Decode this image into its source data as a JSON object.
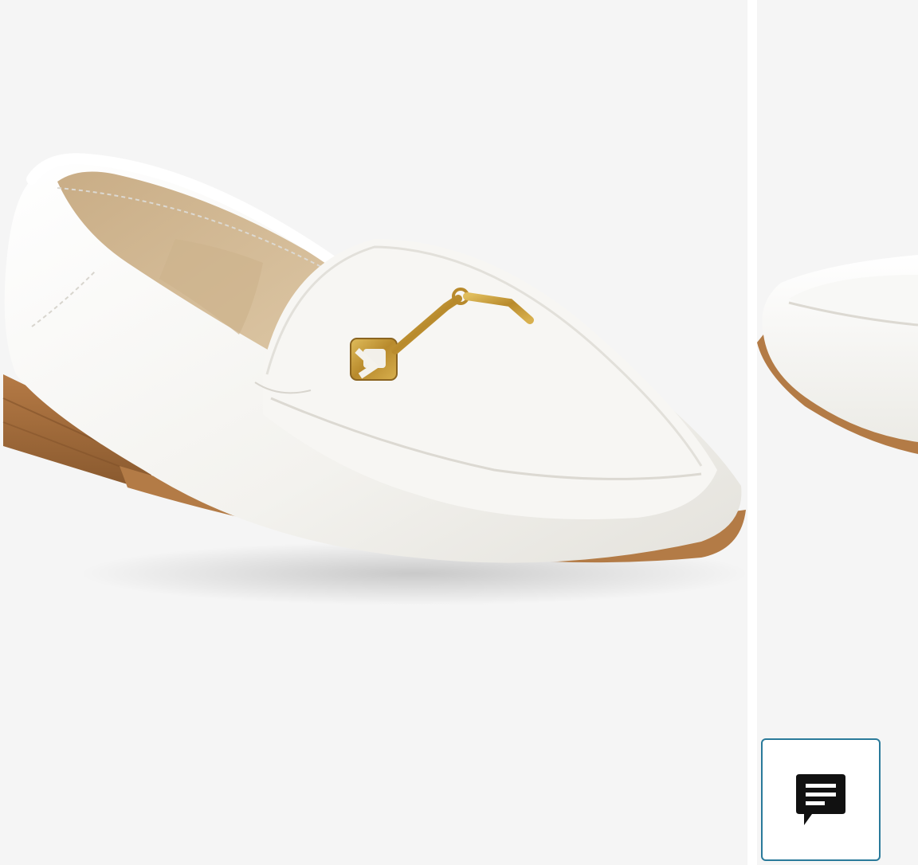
{
  "carousel": {
    "slides": [
      {
        "image": "white-leather-loafer-with-gold-horsebit",
        "alt": ""
      },
      {
        "image": "white-leather-loafer-side-view-partial",
        "alt": ""
      }
    ]
  },
  "feedback": {
    "icon": "chat-feedback-icon",
    "label": ""
  },
  "colors": {
    "background": "#f5f5f5",
    "feedback_border": "#2a7a9a",
    "icon": "#111111",
    "shoe_leather": "#f3f2ee",
    "sole": "#a8703e",
    "hardware_gold": "#c29a3a"
  }
}
